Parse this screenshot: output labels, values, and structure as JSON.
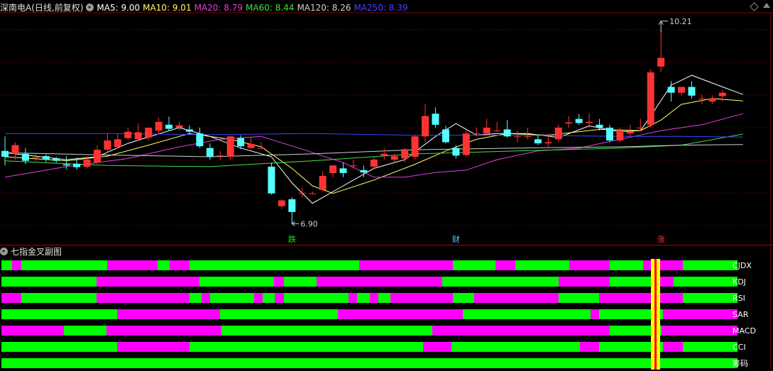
{
  "header": {
    "title": "深南电A(日线,前复权)",
    "ma": [
      {
        "label": "MA5: 9.00",
        "color": "#ffffff"
      },
      {
        "label": "MA10: 9.01",
        "color": "#ffff66"
      },
      {
        "label": "MA20: 8.79",
        "color": "#e040e0"
      },
      {
        "label": "MA60: 8.44",
        "color": "#40e040"
      },
      {
        "label": "MA120: 8.26",
        "color": "#d0d0d0"
      },
      {
        "label": "MA250: 8.39",
        "color": "#4040ff"
      }
    ]
  },
  "colors": {
    "up": "#ff3333",
    "down": "#55ffff",
    "grid": "#8a0000",
    "strip_green": "#00ff00",
    "strip_magenta": "#ff00ff",
    "hl_yellow": "#ffff00",
    "hl_red": "#ff0000"
  },
  "chart_data": {
    "type": "candlestick",
    "ylim": [
      6.55,
      10.5
    ],
    "high_label": "10.21",
    "low_label": "6.90",
    "high_value": 10.21,
    "low_value": 6.9,
    "candles": [
      {
        "o": 8.15,
        "h": 8.4,
        "c": 8.05,
        "l": 7.9
      },
      {
        "o": 8.1,
        "h": 8.3,
        "c": 8.25,
        "l": 8.0
      },
      {
        "o": 8.1,
        "h": 8.2,
        "c": 7.98,
        "l": 7.92
      },
      {
        "o": 8.04,
        "h": 8.1,
        "c": 8.04,
        "l": 7.98
      },
      {
        "o": 8.06,
        "h": 8.09,
        "c": 8.0,
        "l": 7.96
      },
      {
        "o": 8.02,
        "h": 8.05,
        "c": 7.98,
        "l": 7.95
      },
      {
        "o": 7.92,
        "h": 8.06,
        "c": 7.9,
        "l": 7.84
      },
      {
        "o": 7.93,
        "h": 8.04,
        "c": 7.87,
        "l": 7.83
      },
      {
        "o": 7.88,
        "h": 8.06,
        "c": 8.0,
        "l": 7.85
      },
      {
        "o": 7.95,
        "h": 8.25,
        "c": 8.17,
        "l": 7.93
      },
      {
        "o": 8.17,
        "h": 8.45,
        "c": 8.33,
        "l": 8.12
      },
      {
        "o": 8.22,
        "h": 8.45,
        "c": 8.35,
        "l": 8.2
      },
      {
        "o": 8.37,
        "h": 8.55,
        "c": 8.48,
        "l": 8.35
      },
      {
        "o": 8.35,
        "h": 8.62,
        "c": 8.47,
        "l": 8.33
      },
      {
        "o": 8.38,
        "h": 8.55,
        "c": 8.55,
        "l": 8.33
      },
      {
        "o": 8.5,
        "h": 8.72,
        "c": 8.65,
        "l": 8.45
      },
      {
        "o": 8.6,
        "h": 8.74,
        "c": 8.53,
        "l": 8.5
      },
      {
        "o": 8.55,
        "h": 8.65,
        "c": 8.59,
        "l": 8.5
      },
      {
        "o": 8.52,
        "h": 8.59,
        "c": 8.48,
        "l": 8.44
      },
      {
        "o": 8.45,
        "h": 8.55,
        "c": 8.23,
        "l": 8.2
      },
      {
        "o": 8.2,
        "h": 8.28,
        "c": 8.05,
        "l": 8.0
      },
      {
        "o": 8.07,
        "h": 8.15,
        "c": 8.07,
        "l": 8.0
      },
      {
        "o": 8.05,
        "h": 8.4,
        "c": 8.4,
        "l": 8.0
      },
      {
        "o": 8.37,
        "h": 8.42,
        "c": 8.23,
        "l": 8.18
      },
      {
        "o": 8.2,
        "h": 8.38,
        "c": 8.27,
        "l": 8.18
      },
      {
        "o": 8.2,
        "h": 8.3,
        "c": 8.2,
        "l": 8.2
      },
      {
        "o": 7.88,
        "h": 7.95,
        "c": 7.42,
        "l": 7.4
      },
      {
        "o": 7.2,
        "h": 7.32,
        "c": 7.3,
        "l": 7.15
      },
      {
        "o": 7.32,
        "h": 7.35,
        "c": 7.1,
        "l": 6.9
      },
      {
        "o": 7.42,
        "h": 7.52,
        "c": 7.43,
        "l": 7.35
      },
      {
        "o": 7.42,
        "h": 7.45,
        "c": 7.42,
        "l": 7.4
      },
      {
        "o": 7.48,
        "h": 7.8,
        "c": 7.72,
        "l": 7.45
      },
      {
        "o": 7.77,
        "h": 7.9,
        "c": 7.9,
        "l": 7.7
      },
      {
        "o": 7.85,
        "h": 7.95,
        "c": 7.77,
        "l": 7.7
      },
      {
        "o": 7.9,
        "h": 8.0,
        "c": 7.9,
        "l": 7.85
      },
      {
        "o": 7.82,
        "h": 7.9,
        "c": 7.78,
        "l": 7.7
      },
      {
        "o": 7.88,
        "h": 8.05,
        "c": 8.0,
        "l": 7.85
      },
      {
        "o": 8.07,
        "h": 8.2,
        "c": 8.1,
        "l": 8.0
      },
      {
        "o": 8.0,
        "h": 8.1,
        "c": 8.06,
        "l": 7.95
      },
      {
        "o": 8.02,
        "h": 8.2,
        "c": 8.18,
        "l": 7.95
      },
      {
        "o": 8.05,
        "h": 8.42,
        "c": 8.4,
        "l": 8.0
      },
      {
        "o": 8.4,
        "h": 8.95,
        "c": 8.75,
        "l": 8.3
      },
      {
        "o": 8.79,
        "h": 8.9,
        "c": 8.6,
        "l": 8.55
      },
      {
        "o": 8.52,
        "h": 8.58,
        "c": 8.3,
        "l": 8.28
      },
      {
        "o": 8.2,
        "h": 8.25,
        "c": 8.07,
        "l": 8.02
      },
      {
        "o": 8.08,
        "h": 8.5,
        "c": 8.45,
        "l": 8.05
      },
      {
        "o": 8.45,
        "h": 8.55,
        "c": 8.45,
        "l": 8.4
      },
      {
        "o": 8.45,
        "h": 8.7,
        "c": 8.55,
        "l": 8.42
      },
      {
        "o": 8.5,
        "h": 8.65,
        "c": 8.5,
        "l": 8.48
      },
      {
        "o": 8.52,
        "h": 8.68,
        "c": 8.4,
        "l": 8.38
      },
      {
        "o": 8.4,
        "h": 8.5,
        "c": 8.4,
        "l": 8.3
      },
      {
        "o": 8.4,
        "h": 8.55,
        "c": 8.4,
        "l": 8.35
      },
      {
        "o": 8.35,
        "h": 8.42,
        "c": 8.28,
        "l": 8.25
      },
      {
        "o": 8.28,
        "h": 8.45,
        "c": 8.3,
        "l": 8.22
      },
      {
        "o": 8.35,
        "h": 8.6,
        "c": 8.55,
        "l": 8.3
      },
      {
        "o": 8.62,
        "h": 8.75,
        "c": 8.64,
        "l": 8.55
      },
      {
        "o": 8.7,
        "h": 8.78,
        "c": 8.63,
        "l": 8.6
      },
      {
        "o": 8.63,
        "h": 8.8,
        "c": 8.65,
        "l": 8.55
      },
      {
        "o": 8.6,
        "h": 8.7,
        "c": 8.55,
        "l": 8.5
      },
      {
        "o": 8.55,
        "h": 8.6,
        "c": 8.33,
        "l": 8.3
      },
      {
        "o": 8.33,
        "h": 8.55,
        "c": 8.5,
        "l": 8.3
      },
      {
        "o": 8.45,
        "h": 8.6,
        "c": 8.48,
        "l": 8.4
      },
      {
        "o": 8.55,
        "h": 8.7,
        "c": 8.55,
        "l": 8.5
      },
      {
        "o": 8.6,
        "h": 9.55,
        "c": 9.5,
        "l": 8.55
      },
      {
        "o": 9.6,
        "h": 10.21,
        "c": 9.75,
        "l": 9.5
      },
      {
        "o": 9.25,
        "h": 9.35,
        "c": 9.15,
        "l": 9.0
      },
      {
        "o": 9.15,
        "h": 9.25,
        "c": 9.25,
        "l": 9.1
      },
      {
        "o": 9.25,
        "h": 9.35,
        "c": 9.1,
        "l": 9.05
      },
      {
        "o": 9.05,
        "h": 9.12,
        "c": 9.05,
        "l": 8.95
      },
      {
        "o": 9.0,
        "h": 9.1,
        "c": 9.05,
        "l": 8.95
      },
      {
        "o": 9.09,
        "h": 9.2,
        "c": 9.15,
        "l": 9.0
      }
    ],
    "ma_series": [
      {
        "name": "MA5",
        "color": "#ffffff",
        "values": [
          [
            0,
            8.12
          ],
          [
            6,
            8.0
          ],
          [
            9,
            8.05
          ],
          [
            12,
            8.28
          ],
          [
            17,
            8.55
          ],
          [
            20,
            8.4
          ],
          [
            23,
            8.2
          ],
          [
            26,
            8.05
          ],
          [
            28,
            7.6
          ],
          [
            30,
            7.25
          ],
          [
            33,
            7.55
          ],
          [
            36,
            7.85
          ],
          [
            39,
            8.0
          ],
          [
            42,
            8.4
          ],
          [
            44,
            8.62
          ],
          [
            46,
            8.42
          ],
          [
            48,
            8.45
          ],
          [
            51,
            8.45
          ],
          [
            54,
            8.38
          ],
          [
            57,
            8.58
          ],
          [
            60,
            8.48
          ],
          [
            62,
            8.5
          ],
          [
            63,
            8.75
          ],
          [
            65,
            9.28
          ],
          [
            67,
            9.45
          ],
          [
            70,
            9.25
          ],
          [
            72,
            9.12
          ]
        ]
      },
      {
        "name": "MA10",
        "color": "#ffff66",
        "values": [
          [
            0,
            8.05
          ],
          [
            6,
            7.98
          ],
          [
            10,
            8.06
          ],
          [
            14,
            8.25
          ],
          [
            18,
            8.45
          ],
          [
            22,
            8.35
          ],
          [
            25,
            8.22
          ],
          [
            28,
            7.85
          ],
          [
            30,
            7.55
          ],
          [
            32,
            7.42
          ],
          [
            36,
            7.65
          ],
          [
            40,
            7.92
          ],
          [
            43,
            8.15
          ],
          [
            46,
            8.35
          ],
          [
            49,
            8.45
          ],
          [
            53,
            8.42
          ],
          [
            58,
            8.52
          ],
          [
            62,
            8.5
          ],
          [
            64,
            8.68
          ],
          [
            66,
            8.95
          ],
          [
            69,
            9.05
          ],
          [
            72,
            9.01
          ]
        ]
      },
      {
        "name": "MA20",
        "color": "#e040e0",
        "values": [
          [
            0,
            7.7
          ],
          [
            6,
            7.88
          ],
          [
            12,
            8.02
          ],
          [
            17,
            8.22
          ],
          [
            21,
            8.35
          ],
          [
            25,
            8.4
          ],
          [
            29,
            8.18
          ],
          [
            33,
            7.95
          ],
          [
            36,
            7.7
          ],
          [
            39,
            7.7
          ],
          [
            42,
            7.78
          ],
          [
            45,
            7.82
          ],
          [
            48,
            8.0
          ],
          [
            52,
            8.15
          ],
          [
            56,
            8.2
          ],
          [
            60,
            8.35
          ],
          [
            64,
            8.5
          ],
          [
            68,
            8.6
          ],
          [
            72,
            8.79
          ]
        ]
      },
      {
        "name": "MA60",
        "color": "#40e040",
        "values": [
          [
            0,
            7.98
          ],
          [
            10,
            7.9
          ],
          [
            20,
            7.88
          ],
          [
            30,
            7.98
          ],
          [
            40,
            8.1
          ],
          [
            50,
            8.15
          ],
          [
            60,
            8.2
          ],
          [
            66,
            8.25
          ],
          [
            72,
            8.44
          ]
        ]
      },
      {
        "name": "MA120",
        "color": "#d0d0d0",
        "values": [
          [
            0,
            8.12
          ],
          [
            10,
            8.08
          ],
          [
            20,
            8.05
          ],
          [
            30,
            8.1
          ],
          [
            40,
            8.17
          ],
          [
            50,
            8.2
          ],
          [
            60,
            8.22
          ],
          [
            66,
            8.25
          ],
          [
            72,
            8.26
          ]
        ]
      },
      {
        "name": "MA250",
        "color": "#4040ff",
        "values": [
          [
            0,
            8.45
          ],
          [
            10,
            8.45
          ],
          [
            20,
            8.43
          ],
          [
            30,
            8.45
          ],
          [
            40,
            8.42
          ],
          [
            50,
            8.42
          ],
          [
            60,
            8.4
          ],
          [
            66,
            8.4
          ],
          [
            72,
            8.39
          ]
        ]
      }
    ],
    "markers": [
      {
        "index": 28,
        "text": "跌",
        "color": "#00ff00"
      },
      {
        "index": 44,
        "text": "财",
        "color": "#55ccff"
      },
      {
        "index": 64,
        "text": "涨",
        "color": "#ff3333"
      }
    ]
  },
  "panel": {
    "title": "七指金叉副图",
    "strips": [
      {
        "label": "CJDX",
        "segments": [
          [
            "g",
            0,
            15
          ],
          [
            "m",
            15,
            28
          ],
          [
            "g",
            28,
            149
          ],
          [
            "m",
            149,
            220
          ],
          [
            "g",
            220,
            237
          ],
          [
            "m",
            237,
            265
          ],
          [
            "g",
            265,
            504
          ],
          [
            "m",
            504,
            636
          ],
          [
            "g",
            636,
            696
          ],
          [
            "m",
            696,
            724
          ],
          [
            "g",
            724,
            800
          ],
          [
            "m",
            800,
            857
          ],
          [
            "g",
            857,
            904
          ],
          [
            "m",
            904,
            960
          ],
          [
            "g",
            960,
            1037
          ]
        ]
      },
      {
        "label": "KDJ",
        "segments": [
          [
            "g",
            0,
            134
          ],
          [
            "m",
            134,
            279
          ],
          [
            "g",
            279,
            384
          ],
          [
            "m",
            384,
            398
          ],
          [
            "g",
            398,
            444
          ],
          [
            "m",
            444,
            621
          ],
          [
            "g",
            621,
            785
          ],
          [
            "m",
            785,
            857
          ],
          [
            "g",
            857,
            918
          ],
          [
            "m",
            918,
            947
          ],
          [
            "g",
            947,
            1037
          ]
        ]
      },
      {
        "label": "RSI",
        "segments": [
          [
            "m",
            0,
            28
          ],
          [
            "g",
            28,
            134
          ],
          [
            "m",
            134,
            265
          ],
          [
            "g",
            265,
            282
          ],
          [
            "m",
            282,
            294
          ],
          [
            "g",
            294,
            356
          ],
          [
            "m",
            356,
            368
          ],
          [
            "g",
            368,
            385
          ],
          [
            "m",
            385,
            398
          ],
          [
            "g",
            398,
            489
          ],
          [
            "m",
            489,
            501
          ],
          [
            "g",
            501,
            519
          ],
          [
            "m",
            519,
            531
          ],
          [
            "g",
            531,
            548
          ],
          [
            "m",
            548,
            636
          ],
          [
            "g",
            636,
            666
          ],
          [
            "m",
            666,
            785
          ],
          [
            "g",
            785,
            842
          ],
          [
            "m",
            842,
            960
          ],
          [
            "g",
            960,
            1037
          ]
        ]
      },
      {
        "label": "SAR",
        "segments": [
          [
            "g",
            0,
            163
          ],
          [
            "m",
            163,
            308
          ],
          [
            "g",
            308,
            474
          ],
          [
            "m",
            474,
            650
          ],
          [
            "g",
            650,
            830
          ],
          [
            "m",
            830,
            842
          ],
          [
            "g",
            842,
            932
          ],
          [
            "m",
            932,
            1037
          ]
        ]
      },
      {
        "label": "MACD",
        "segments": [
          [
            "m",
            0,
            88
          ],
          [
            "g",
            88,
            148
          ],
          [
            "m",
            148,
            310
          ],
          [
            "g",
            310,
            607
          ],
          [
            "m",
            607,
            857
          ],
          [
            "g",
            857,
            930
          ],
          [
            "m",
            930,
            1037
          ]
        ]
      },
      {
        "label": "CCI",
        "segments": [
          [
            "g",
            0,
            163
          ],
          [
            "m",
            163,
            265
          ],
          [
            "g",
            265,
            594
          ],
          [
            "m",
            594,
            634
          ],
          [
            "g",
            634,
            815
          ],
          [
            "m",
            815,
            842
          ],
          [
            "g",
            842,
            932
          ],
          [
            "m",
            932,
            960
          ],
          [
            "g",
            960,
            1037
          ]
        ]
      },
      {
        "label": "筹码",
        "segments": [
          [
            "g",
            0,
            1037
          ]
        ]
      }
    ]
  }
}
